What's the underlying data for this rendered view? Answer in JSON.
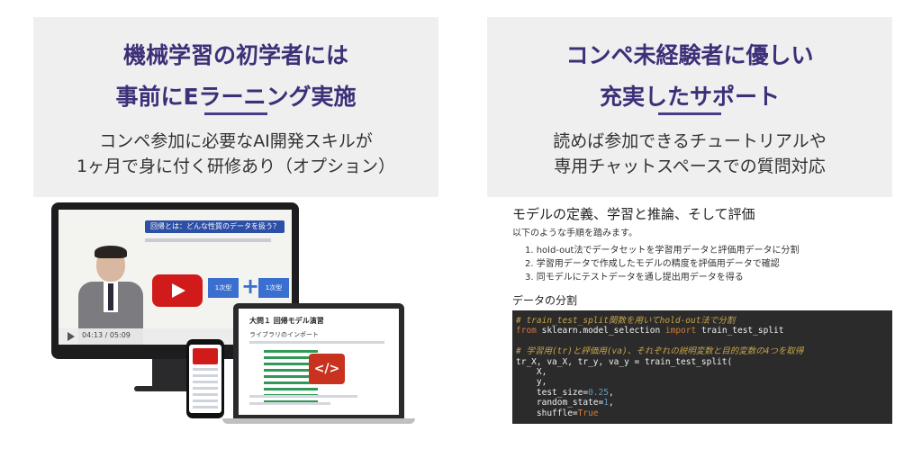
{
  "left_card": {
    "headline": [
      "機械学習の初学者には",
      "事前にEラーニング実施"
    ],
    "subtext": [
      "コンペ参加に必要なAI開発スキルが",
      "1ヶ月で身に付く研修あり（オプション）"
    ],
    "video": {
      "time": "04:13 / 05:09",
      "lesson_title": "回帰とは：どんな性質のデータを扱う？",
      "box_a": "1次型",
      "box_b": "1次型"
    },
    "laptop": {
      "title": "大問１ 回帰モデル演習",
      "subtitle": "ライブラリのインポート",
      "code_icon": "</>"
    }
  },
  "right_card": {
    "headline": [
      "コンペ未経験者に優しい",
      "充実したサポート"
    ],
    "subtext": [
      "読めば参加できるチュートリアルや",
      "専用チャットスペースでの質問対応"
    ],
    "notebook": {
      "title": "モデルの定義、学習と推論、そして評価",
      "lead": "以下のような手順を踏みます。",
      "steps": [
        "1. hold-out法でデータセットを学習用データと評価用データに分割",
        "2. 学習用データで作成したモデルの精度を評価用データで確認",
        "3. 同モデルにテストデータを通し提出用データを得る"
      ],
      "section": "データの分割",
      "code": {
        "comment1": "# train_test_split関数を用いてhold-out法で分割",
        "from_kw": "from",
        "module": " sklearn.model_selection ",
        "import_kw": "import",
        "func": " train_test_split",
        "comment2": "# 学習用(tr)と評価用(va)、それぞれの説明変数と目的変数の4つを取得",
        "call": "tr_X, va_X, tr_y, va_y = train_test_split(",
        "arg1": "    X,",
        "arg2": "    y,",
        "arg3_key": "    test_size=",
        "arg3_val": "0.25",
        "arg4_key": "    random_state=",
        "arg4_val": "1",
        "arg5_key": "    shuffle=",
        "arg5_val": "True"
      }
    }
  },
  "colors": {
    "headline": "#3d2f78",
    "card_bg": "#efefef",
    "code_bg": "#2b2b2b",
    "play_red": "#d11b1b"
  }
}
